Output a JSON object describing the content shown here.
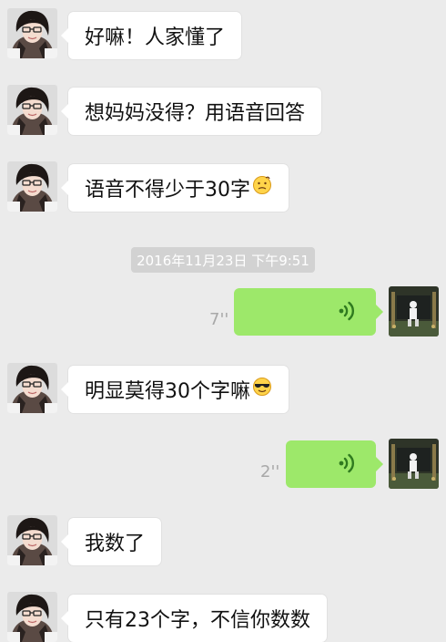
{
  "messages": [
    {
      "text": "好嘛！人家懂了"
    },
    {
      "text": "想妈妈没得？用语音回答"
    },
    {
      "text": "语音不得少于30字"
    },
    {
      "text": "明显莫得30个字嘛"
    },
    {
      "text": "我数了"
    },
    {
      "text": "只有23个字，不信你数数"
    }
  ],
  "timestamp": "2016年11月23日 下午9:51",
  "voice_messages": [
    {
      "duration": "7''"
    },
    {
      "duration": "2''"
    }
  ],
  "colors": {
    "background": "#ebebeb",
    "bubble_incoming": "#ffffff",
    "bubble_voice": "#9de86a",
    "timestamp_bg": "#d2d2d2"
  }
}
